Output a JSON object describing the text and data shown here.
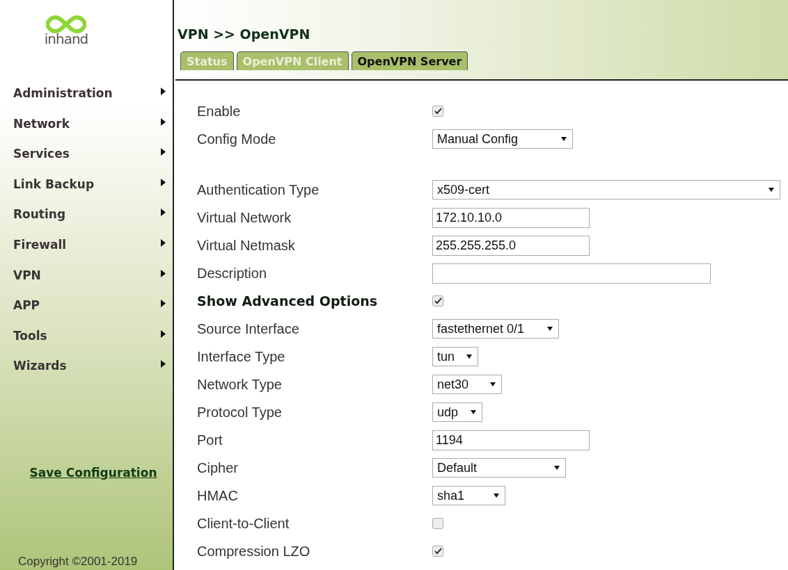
{
  "logo": {
    "text": "inhand"
  },
  "breadcrumb": "VPN >> OpenVPN",
  "tabs": [
    {
      "label": "Status",
      "selected": false
    },
    {
      "label": "OpenVPN Client",
      "selected": false
    },
    {
      "label": "OpenVPN Server",
      "selected": true
    }
  ],
  "sidebar": {
    "items": [
      {
        "label": "Administration"
      },
      {
        "label": "Network"
      },
      {
        "label": "Services"
      },
      {
        "label": "Link Backup"
      },
      {
        "label": "Routing"
      },
      {
        "label": "Firewall"
      },
      {
        "label": "VPN"
      },
      {
        "label": "APP"
      },
      {
        "label": "Tools"
      },
      {
        "label": "Wizards"
      }
    ],
    "save_link": "Save Configuration",
    "copyright": "Copyright ©2001-2019"
  },
  "form": [
    {
      "kind": "checkbox",
      "label": "Enable",
      "checked": true
    },
    {
      "kind": "select",
      "label": "Config Mode",
      "value": "Manual Config"
    },
    {
      "kind": "spacer"
    },
    {
      "kind": "select",
      "label": "Authentication Type",
      "value": "x509-cert"
    },
    {
      "kind": "text",
      "label": "Virtual Network",
      "value": "172.10.10.0"
    },
    {
      "kind": "text",
      "label": "Virtual Netmask",
      "value": "255.255.255.0"
    },
    {
      "kind": "text",
      "label": "Description"
    },
    {
      "kind": "checkbox",
      "label": "Show Advanced Options",
      "checked": true,
      "bold": true
    },
    {
      "kind": "select",
      "label": "Source Interface",
      "value": "fastethernet 0/1"
    },
    {
      "kind": "select",
      "label": "Interface Type",
      "value": "tun"
    },
    {
      "kind": "select",
      "label": "Network Type",
      "value": "net30"
    },
    {
      "kind": "select",
      "label": "Protocol Type",
      "value": "udp"
    },
    {
      "kind": "text",
      "label": "Port",
      "value": "1194"
    },
    {
      "kind": "select",
      "label": "Cipher",
      "value": "Default"
    },
    {
      "kind": "select",
      "label": "HMAC",
      "value": "sha1"
    },
    {
      "kind": "checkbox",
      "label": "Client-to-Client",
      "checked": false
    },
    {
      "kind": "checkbox",
      "label": "Compression LZO",
      "checked": true
    }
  ]
}
